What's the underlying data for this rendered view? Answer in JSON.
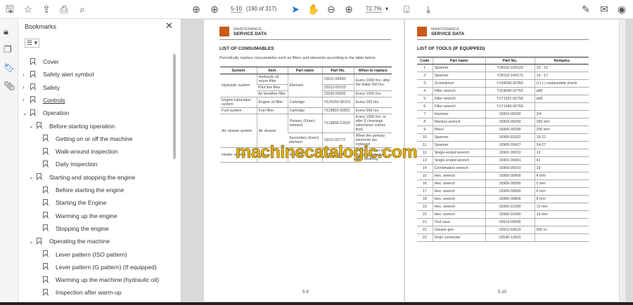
{
  "toolbar": {
    "page_input": "5-10",
    "page_count": "(190 of 317)",
    "zoom": "72.7%"
  },
  "bookmarks": {
    "title": "Bookmarks",
    "items": [
      {
        "label": "Cover",
        "level": 0,
        "chev": ""
      },
      {
        "label": "Safety alert symbol",
        "level": 0,
        "chev": "›"
      },
      {
        "label": "Safety",
        "level": 0,
        "chev": "›"
      },
      {
        "label": "Controls",
        "level": 0,
        "chev": "›",
        "underline": true
      },
      {
        "label": "Operation",
        "level": 0,
        "chev": "⌄"
      },
      {
        "label": "Before starting operation",
        "level": 1,
        "chev": "⌄"
      },
      {
        "label": "Getting on or off the machine",
        "level": 2,
        "chev": ""
      },
      {
        "label": "Walk-around inspection",
        "level": 2,
        "chev": ""
      },
      {
        "label": "Daily inspection",
        "level": 2,
        "chev": ""
      },
      {
        "label": "Starting and stopping the engine",
        "level": 1,
        "chev": "⌄"
      },
      {
        "label": "Before starting the engine",
        "level": 2,
        "chev": ""
      },
      {
        "label": "Starting the Engine",
        "level": 2,
        "chev": ""
      },
      {
        "label": "Warming up the engine",
        "level": 2,
        "chev": ""
      },
      {
        "label": "Stopping the engine",
        "level": 2,
        "chev": ""
      },
      {
        "label": "Operating the machine",
        "level": 1,
        "chev": "⌄"
      },
      {
        "label": "Lever pattern (ISO pattern)",
        "level": 2,
        "chev": ""
      },
      {
        "label": "Lever pattern (G pattern) (If equipped)",
        "level": 2,
        "chev": ""
      },
      {
        "label": "Warming up the machine (hydraulic oil)",
        "level": 2,
        "chev": ""
      },
      {
        "label": "Inspection after warm-up",
        "level": 2,
        "chev": ""
      }
    ]
  },
  "left_page": {
    "header1": "MAINTENANCE",
    "header2": "SERVICE DATA",
    "title": "LIST OF CONSUMABLES",
    "description": "Periodically replace consumables such as filters and elements according to the table below.",
    "columns": [
      "System",
      "Item",
      "Part name",
      "Part No.",
      "When to replace"
    ],
    "rows": [
      [
        [
          "Hydraulic system",
          1,
          3
        ],
        [
          "Hydraulic oil return filter",
          1,
          1
        ],
        [
          "Element",
          1,
          3
        ],
        [
          "15511-03900",
          1,
          1
        ],
        [
          "Every 1000 hrs. after the initial 250 hrs.",
          1,
          2
        ]
      ],
      [
        [
          "Pilot line filter",
          1,
          1
        ],
        [
          "15512-00703",
          1,
          1
        ]
      ],
      [
        [
          "Air breather filter",
          1,
          1
        ],
        [
          "15520-05002",
          1,
          1
        ],
        [
          "Every 1000 hrs.",
          1,
          1
        ]
      ],
      [
        [
          "Engine lubrication system",
          1,
          1
        ],
        [
          "Engine oil filter",
          1,
          1
        ],
        [
          "Cartridge",
          1,
          1
        ],
        [
          "Y129150-35153",
          1,
          1
        ],
        [
          "Every 250 hrs.",
          1,
          1
        ]
      ],
      [
        [
          "Fuel system",
          1,
          1
        ],
        [
          "Fuel filter",
          1,
          1
        ],
        [
          "Cartridge",
          1,
          1
        ],
        [
          "Y119802-55801",
          1,
          1
        ],
        [
          "Every 500 hrs.",
          1,
          1
        ]
      ],
      [
        [
          "Air cleaner system",
          1,
          2
        ],
        [
          "Air cleaner",
          1,
          2
        ],
        [
          "Primary (Outer) element",
          1,
          1
        ],
        [
          "Y119808-12520",
          1,
          1
        ],
        [
          "Every 1000 hrs. or after 6 cleanings (whichever comes first)",
          1,
          1
        ]
      ],
      [
        [
          "Secondary (Inner) element",
          1,
          1
        ],
        [
          "19111-02772",
          1,
          1
        ],
        [
          "When the primary elements are replaced",
          1,
          1
        ]
      ],
      [
        [
          "Heater system",
          1,
          1
        ],
        [
          "Filter",
          1,
          1
        ],
        [
          "Element",
          1,
          1
        ],
        [
          "19115-13880",
          1,
          1
        ],
        [
          "Once a year or if clogging remains after cleaning",
          1,
          1
        ]
      ]
    ],
    "page_number": "5-9"
  },
  "right_page": {
    "header1": "MAINTENANCE",
    "header2": "SERVICE DATA",
    "title": "LIST OF TOOLS (IF EQUIPPED)",
    "columns": [
      "Code",
      "Part name",
      "Part No.",
      "Remarks"
    ],
    "rows": [
      [
        "1",
        "Spanner",
        "Y28110-100120",
        "10 - 12"
      ],
      [
        "2",
        "Spanner",
        "Y28110-140170",
        "14 - 17"
      ],
      [
        "3",
        "Screwdriver",
        "Y104200-92350",
        "(+) (-) replaceable shank"
      ],
      [
        "4",
        "Filter wrench",
        "Y119640-92750",
        "ø80"
      ],
      [
        "5",
        "Filter wrench",
        "Y171301-92750",
        "ø90"
      ],
      [
        "6",
        "Filter wrench",
        "Y171340-92760",
        ""
      ],
      [
        "7",
        "Hammer",
        "16903-00330",
        "3/4"
      ],
      [
        "8",
        "Monkey wrench",
        "16904-00250",
        "250 mm"
      ],
      [
        "9",
        "Pliers",
        "16905-00200",
        "200 mm"
      ],
      [
        "10",
        "Spanner",
        "16900-01922",
        "19-22"
      ],
      [
        "11",
        "Spanner",
        "16900-02427",
        "24-27"
      ],
      [
        "12",
        "Single-ended wrench",
        "16901-00013",
        "13"
      ],
      [
        "13",
        "Single-ended wrench",
        "16901-00041",
        "41"
      ],
      [
        "14",
        "Combination wrench",
        "16909-00019",
        "19"
      ],
      [
        "15",
        "Hex. wrench",
        "16906-00400",
        "4 mm"
      ],
      [
        "16",
        "Hex. wrench",
        "16906-00500",
        "5 mm"
      ],
      [
        "17",
        "Hex. wrench",
        "16906-00600",
        "6 mm"
      ],
      [
        "18",
        "Hex. wrench",
        "16906-00800",
        "8 mm"
      ],
      [
        "19",
        "Hex. wrench",
        "16906-01000",
        "10 mm"
      ],
      [
        "20",
        "Hex. wrench",
        "16906-01400",
        "14 mm"
      ],
      [
        "21",
        "Tool case",
        "16914-00005",
        ""
      ],
      [
        "22",
        "Grease gun",
        "16910-60610",
        "500 cc"
      ],
      [
        "23",
        "Drain connector",
        "15545-12601",
        ""
      ]
    ],
    "page_number": "5-10"
  },
  "watermark": "machinecatalogic.com"
}
